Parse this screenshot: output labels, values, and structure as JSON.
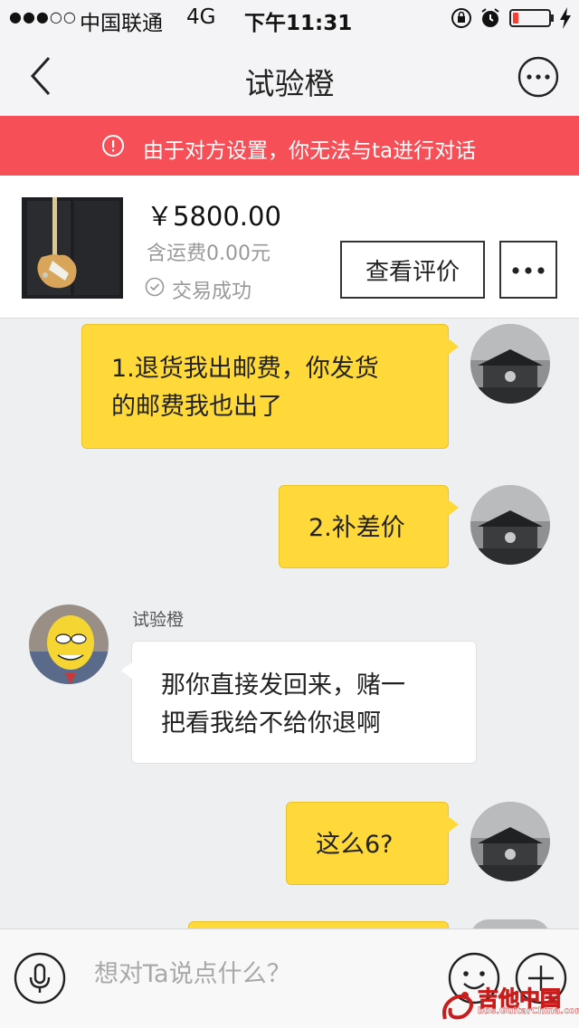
{
  "status_bar": {
    "signal": "●●●○○",
    "carrier": "中国联通",
    "network": "4G",
    "time": "下午11:31",
    "battery_level": 0.15,
    "battery_color": "#ff3b30"
  },
  "nav": {
    "title": "试验橙",
    "back_icon": "chevron-left-icon",
    "more_icon": "more-circle-icon"
  },
  "banner": {
    "text": "由于对方设置，你无法与ta进行对话",
    "color": "#f74f57",
    "icon": "info-icon"
  },
  "product": {
    "price": "￥5800.00",
    "shipping": "含运费0.00元",
    "status": "交易成功",
    "review_button": "查看评价",
    "more_icon": "more-dots-icon"
  },
  "messages": [
    {
      "from": "me",
      "lines": [
        "1.退货我出邮费，你发货",
        "的邮费我也出了"
      ]
    },
    {
      "from": "me",
      "lines": [
        "2.补差价"
      ]
    },
    {
      "from": "them",
      "sender": "试验橙",
      "lines": [
        "那你直接发回来，赌一",
        "把看我给不给你退啊"
      ]
    },
    {
      "from": "me",
      "lines": [
        "这么6?"
      ]
    }
  ],
  "input": {
    "placeholder": "想对Ta说点什么？",
    "voice_icon": "microphone-icon",
    "emoji_icon": "emoji-icon",
    "plus_icon": "plus-circle-icon"
  },
  "watermark": {
    "name": "吉他中国",
    "url": "bbs.GuitarChina.com"
  },
  "colors": {
    "mine_bubble": "#ffd939",
    "theirs_bubble": "#ffffff",
    "background": "#eeeff1"
  }
}
